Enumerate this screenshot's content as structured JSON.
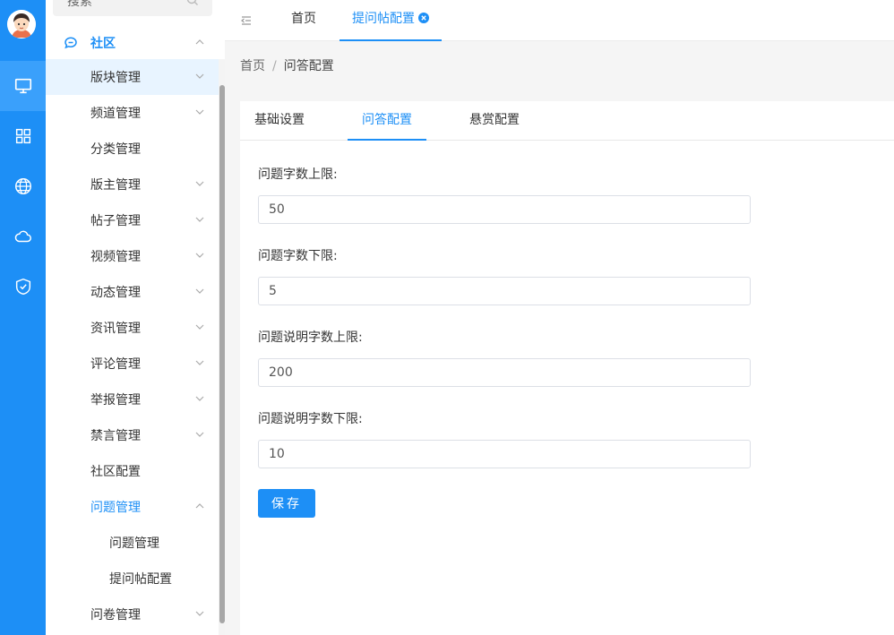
{
  "colors": {
    "primary": "#1d8ff6",
    "rail_active": "#3aa0fb",
    "menu_highlight": "#e8f4ff"
  },
  "rail": {
    "items": [
      {
        "icon": "monitor-icon",
        "active": true
      },
      {
        "icon": "grid-icon",
        "active": false
      },
      {
        "icon": "globe-icon",
        "active": false
      },
      {
        "icon": "cloud-icon",
        "active": false
      },
      {
        "icon": "shield-check-icon",
        "active": false
      }
    ]
  },
  "sidebar": {
    "search_text": "搜索",
    "group": {
      "label": "社区",
      "icon": "chat-icon",
      "expanded": true
    },
    "items": [
      {
        "label": "版块管理",
        "has_children": true,
        "highlighted": true
      },
      {
        "label": "频道管理",
        "has_children": true
      },
      {
        "label": "分类管理",
        "has_children": false
      },
      {
        "label": "版主管理",
        "has_children": true
      },
      {
        "label": "帖子管理",
        "has_children": true
      },
      {
        "label": "视频管理",
        "has_children": true
      },
      {
        "label": "动态管理",
        "has_children": true
      },
      {
        "label": "资讯管理",
        "has_children": true
      },
      {
        "label": "评论管理",
        "has_children": true
      },
      {
        "label": "举报管理",
        "has_children": true
      },
      {
        "label": "禁言管理",
        "has_children": true
      },
      {
        "label": "社区配置",
        "has_children": false
      },
      {
        "label": "问题管理",
        "has_children": true,
        "expanded": true,
        "active": true
      },
      {
        "label": "问题管理",
        "sub": true
      },
      {
        "label": "提问帖配置",
        "sub": true
      },
      {
        "label": "问卷管理",
        "has_children": true
      }
    ]
  },
  "topbar": {
    "home_tab": "首页",
    "current_tab": "提问帖配置"
  },
  "breadcrumb": {
    "home": "首页",
    "separator": "/",
    "current": "问答配置"
  },
  "tabs": [
    {
      "label": "基础设置",
      "active": false
    },
    {
      "label": "问答配置",
      "active": true
    },
    {
      "label": "悬赏配置",
      "active": false
    }
  ],
  "form": {
    "fields": [
      {
        "label": "问题字数上限:",
        "value": "50"
      },
      {
        "label": "问题字数下限:",
        "value": "5"
      },
      {
        "label": "问题说明字数上限:",
        "value": "200"
      },
      {
        "label": "问题说明字数下限:",
        "value": "10"
      }
    ],
    "save_label": "保存"
  }
}
